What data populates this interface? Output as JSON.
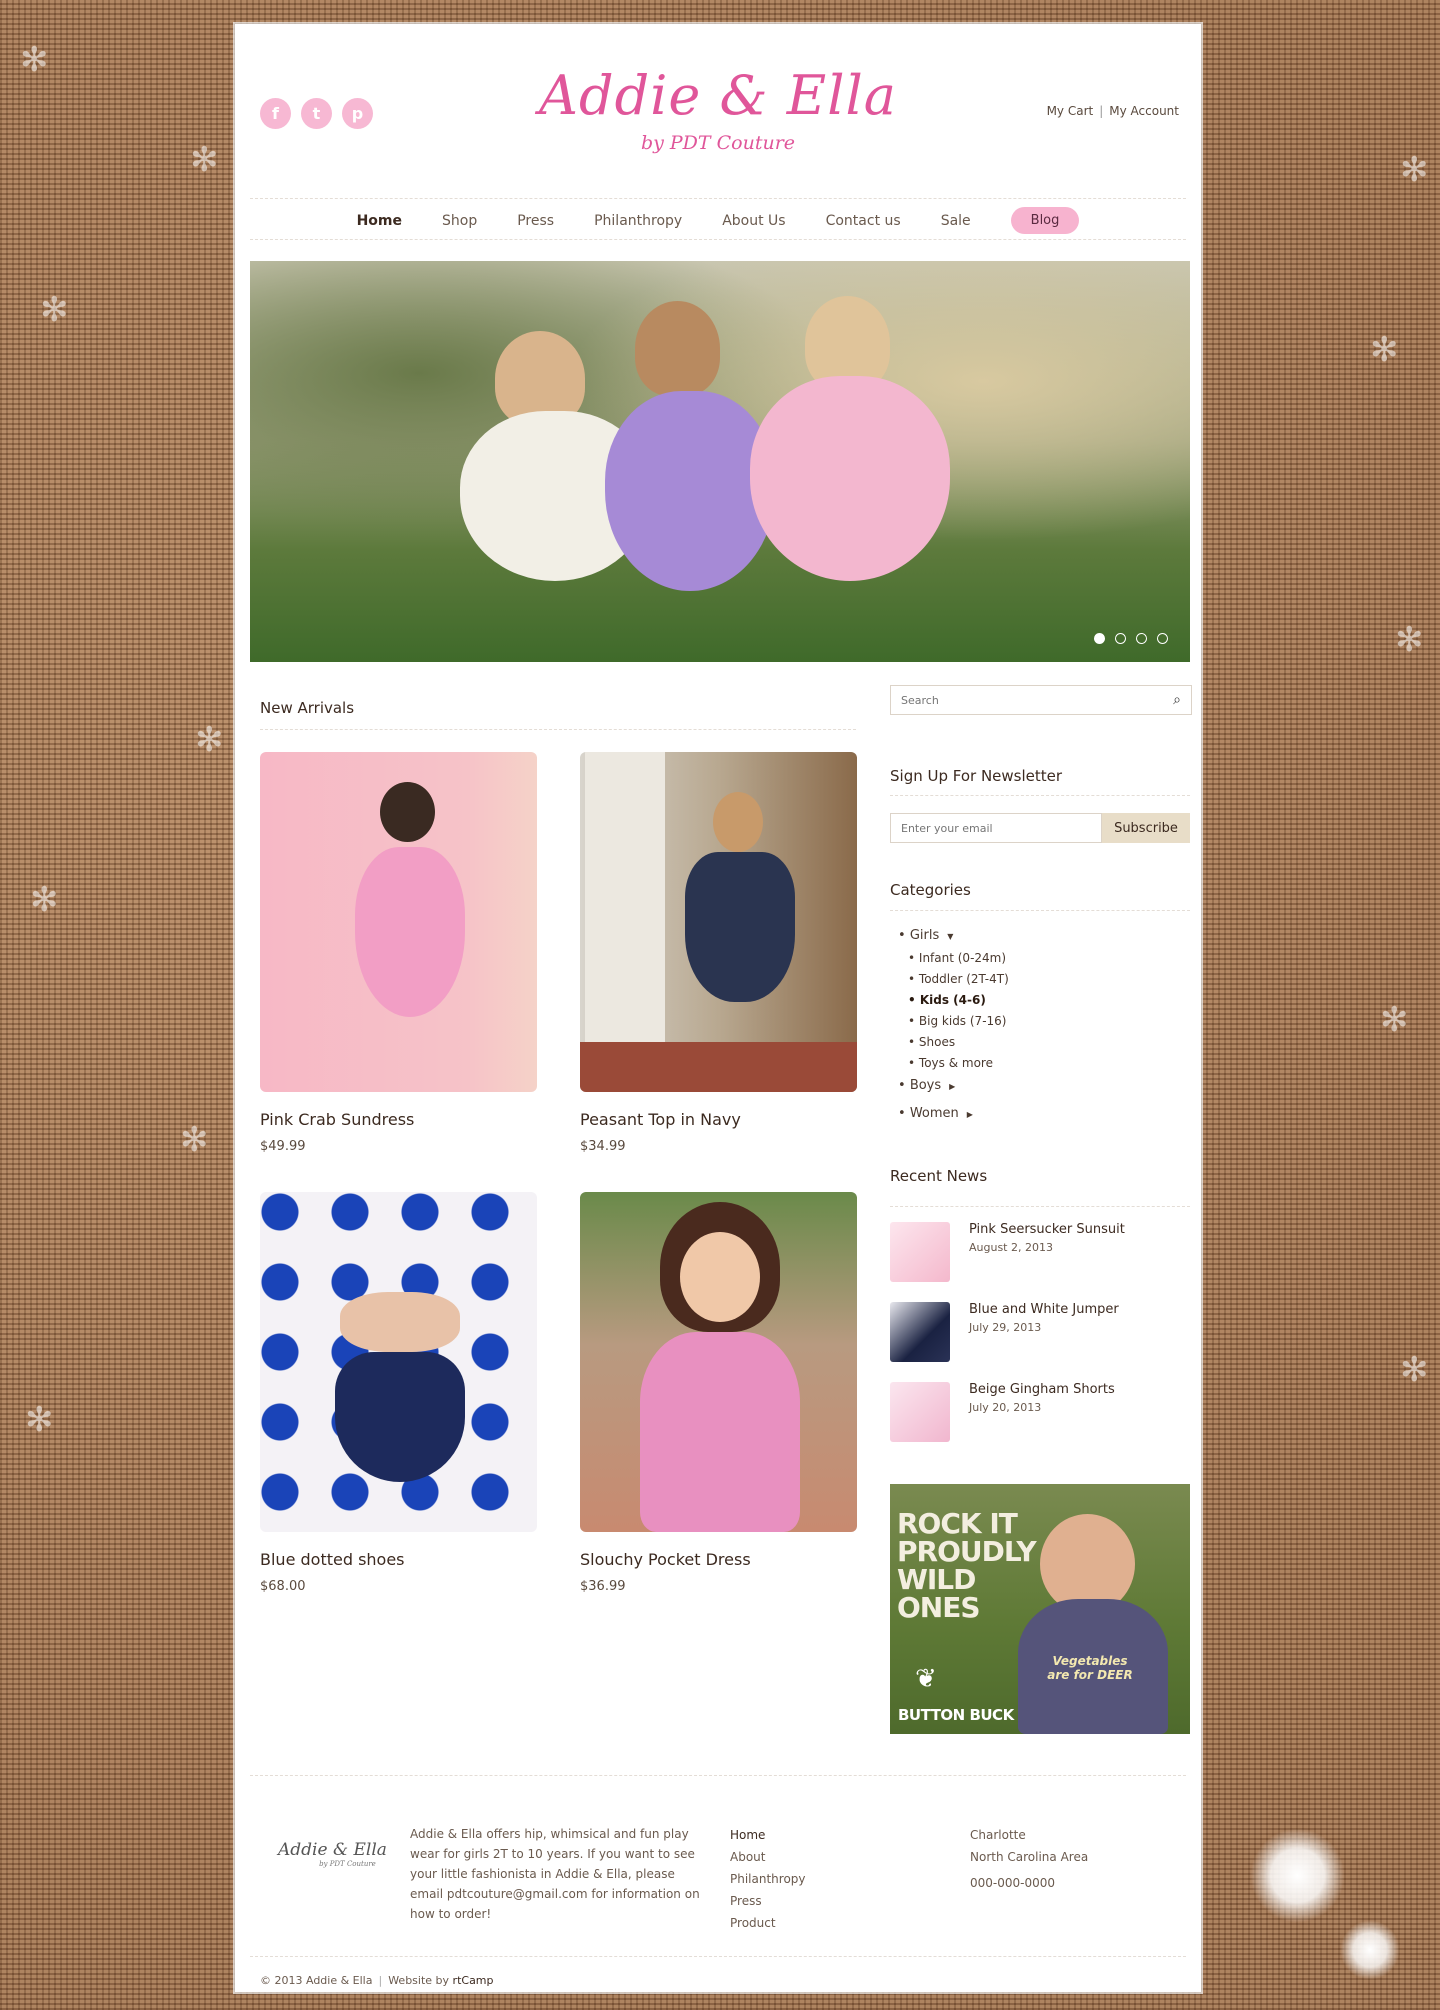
{
  "header": {
    "social": [
      {
        "name": "facebook",
        "glyph": "f"
      },
      {
        "name": "twitter",
        "glyph": "t"
      },
      {
        "name": "pinterest",
        "glyph": "p"
      }
    ],
    "logo_title": "Addie & Ella",
    "logo_tagline": "by PDT Couture",
    "my_cart": "My Cart",
    "my_account": "My Account",
    "separator": "|"
  },
  "nav": [
    {
      "label": "Home",
      "active": true
    },
    {
      "label": "Shop"
    },
    {
      "label": "Press"
    },
    {
      "label": "Philanthropy"
    },
    {
      "label": "About Us"
    },
    {
      "label": "Contact us"
    },
    {
      "label": "Sale"
    }
  ],
  "nav_blog": "Blog",
  "slider": {
    "slides": 4,
    "active": 1
  },
  "new_arrivals": {
    "title": "New Arrivals",
    "products": [
      {
        "name": "Pink Crab Sundress",
        "price": "$49.99"
      },
      {
        "name": "Peasant Top in Navy",
        "price": "$34.99"
      },
      {
        "name": "Blue dotted shoes",
        "price": "$68.00"
      },
      {
        "name": "Slouchy Pocket Dress",
        "price": "$36.99"
      }
    ]
  },
  "sidebar": {
    "search_placeholder": "Search",
    "newsletter_title": "Sign Up For Newsletter",
    "email_placeholder": "Enter your email",
    "subscribe": "Subscribe",
    "categories_title": "Categories",
    "categories": {
      "girls": "Girls",
      "girls_sub": [
        "Infant (0-24m)",
        "Toddler (2T-4T)",
        "Kids (4-6)",
        "Big kids (7-16)",
        "Shoes",
        "Toys & more"
      ],
      "boys": "Boys",
      "women": "Women"
    },
    "recent_news_title": "Recent News",
    "news": [
      {
        "title": "Pink Seersucker Sunsuit",
        "date": "August 2, 2013"
      },
      {
        "title": "Blue and White Jumper",
        "date": "July 29, 2013"
      },
      {
        "title": "Beige Gingham Shorts",
        "date": "July 20, 2013"
      }
    ],
    "ad": {
      "text": "ROCK IT PROUDLY WILD ONES",
      "brand": "BUTTON BUCK",
      "shirt": "Vegetables are for DEER"
    }
  },
  "footer": {
    "logo": "Addie & Ella",
    "logo_sub": "by PDT Couture",
    "description": "Addie & Ella offers hip, whimsical and fun play wear for girls 2T to 10 years. If you want to see your little fashionista in Addie & Ella, please email pdtcouture@gmail.com for information on how to order!",
    "links": [
      "Home",
      "About",
      "Philanthropy",
      "Press",
      "Product"
    ],
    "city": "Charlotte",
    "area": "North Carolina Area",
    "phone": "000-000-0000",
    "copyright": "© 2013 Addie & Ella",
    "website_by": "Website by",
    "developer": "rtCamp"
  },
  "colors": {
    "accent_pink": "#e0569a",
    "blog_pink": "#f7b3cf",
    "social_pink": "#f7b8d3",
    "subscribe_bg": "#e8ddc8"
  }
}
